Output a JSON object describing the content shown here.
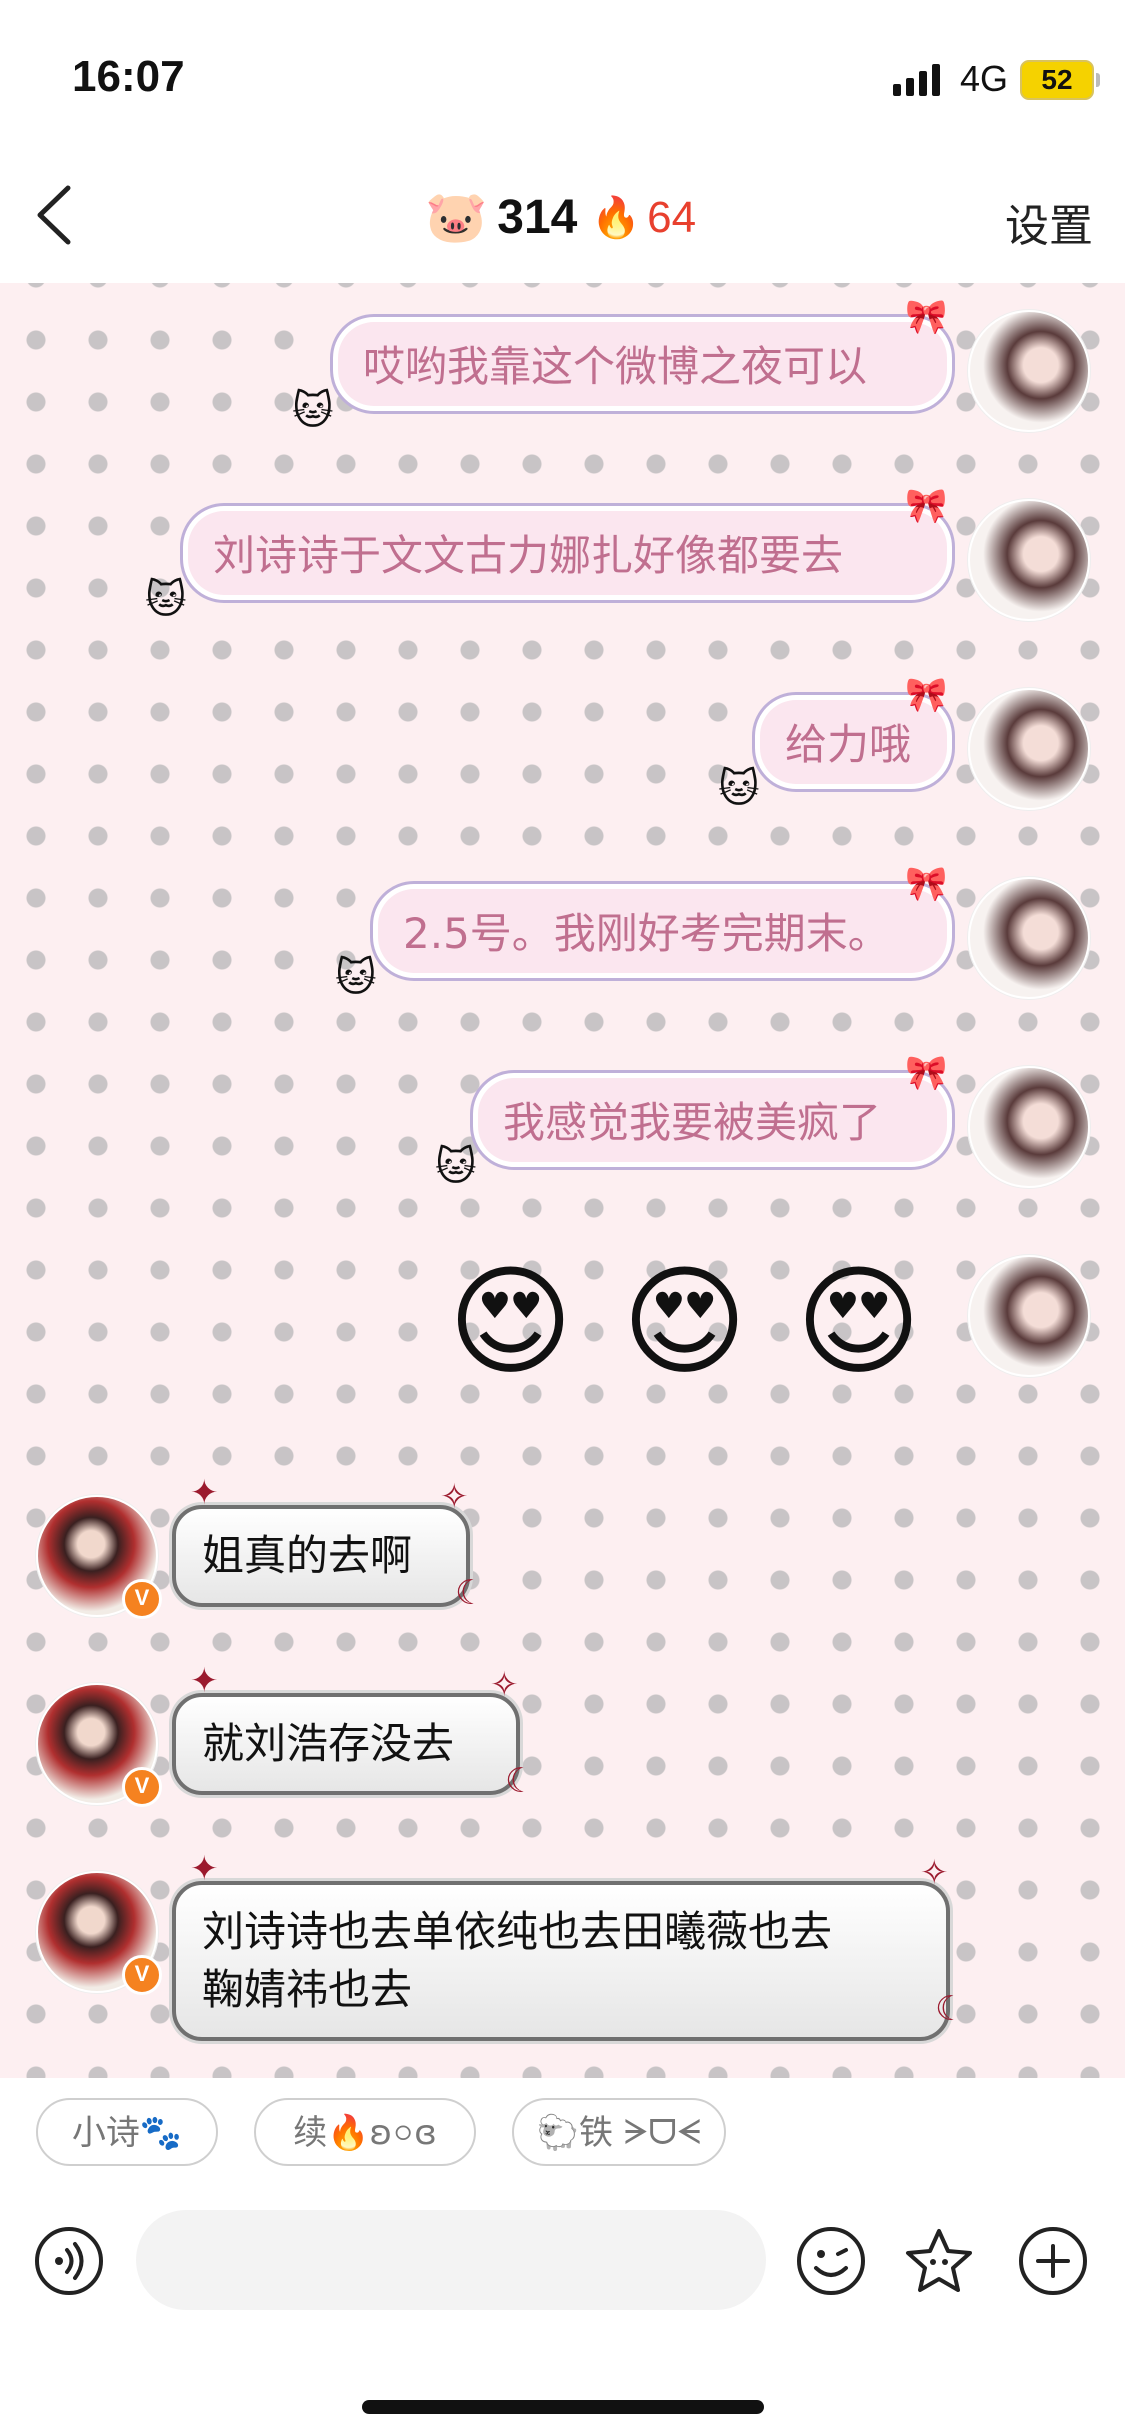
{
  "status_bar": {
    "time": "16:07",
    "network": "4G",
    "battery": "52"
  },
  "nav": {
    "pig_icon": "🐷",
    "score": "314",
    "fire_icon": "🔥",
    "fire_count": "64",
    "settings_label": "设置"
  },
  "messages_right": [
    {
      "text": "哎哟我靠这个微博之夜可以"
    },
    {
      "text": "刘诗诗于文文古力娜扎好像都要去"
    },
    {
      "text": "给力哦"
    },
    {
      "text": "2.5号。我刚好考完期末。"
    },
    {
      "text": "我感觉我要被美疯了"
    }
  ],
  "emoji_message": {
    "emojis": [
      "😍",
      "😍",
      "😍"
    ]
  },
  "messages_left": [
    {
      "text": "姐真的去啊"
    },
    {
      "text": "就刘浩存没去"
    },
    {
      "line1": "刘诗诗也去单依纯也去田曦薇也去",
      "line2": "鞠婧祎也去"
    }
  ],
  "verified_badge": "V",
  "chips": [
    {
      "label": "小诗🐾"
    },
    {
      "label": "续🔥ʚ০ɞ"
    },
    {
      "label": "🐑铁 ᗒᗜᗕ"
    }
  ],
  "input": {
    "placeholder": ""
  },
  "colors": {
    "chat_bg": "#fdeff1",
    "bubble_right_text": "#c06f8f",
    "fire": "#e8402e",
    "badge": "#f58220"
  }
}
